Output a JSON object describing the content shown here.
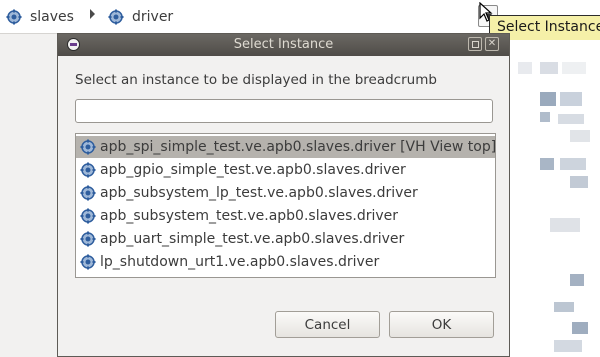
{
  "breadcrumb": {
    "items": [
      {
        "label": "slaves",
        "icon": "component-icon"
      },
      {
        "label": "driver",
        "icon": "component-icon"
      }
    ],
    "tooltip": "Select Instance"
  },
  "dialog": {
    "title": "Select Instance",
    "prompt": "Select an instance to be displayed in the breadcrumb",
    "filter": {
      "value": "",
      "placeholder": ""
    },
    "instances": [
      {
        "label": "apb_spi_simple_test.ve.apb0.slaves.driver [VH View top]",
        "selected": true
      },
      {
        "label": "apb_gpio_simple_test.ve.apb0.slaves.driver",
        "selected": false
      },
      {
        "label": "apb_subsystem_lp_test.ve.apb0.slaves.driver",
        "selected": false
      },
      {
        "label": "apb_subsystem_test.ve.apb0.slaves.driver",
        "selected": false
      },
      {
        "label": "apb_uart_simple_test.ve.apb0.slaves.driver",
        "selected": false
      },
      {
        "label": "lp_shutdown_urt1.ve.apb0.slaves.driver",
        "selected": false
      }
    ],
    "buttons": {
      "cancel": "Cancel",
      "ok": "OK"
    }
  },
  "colors": {
    "titlebar": "#5a5752",
    "selection": "#b5b2ad",
    "tooltip": "#f5f0a8",
    "icon_blue": "#2f5e9e"
  }
}
